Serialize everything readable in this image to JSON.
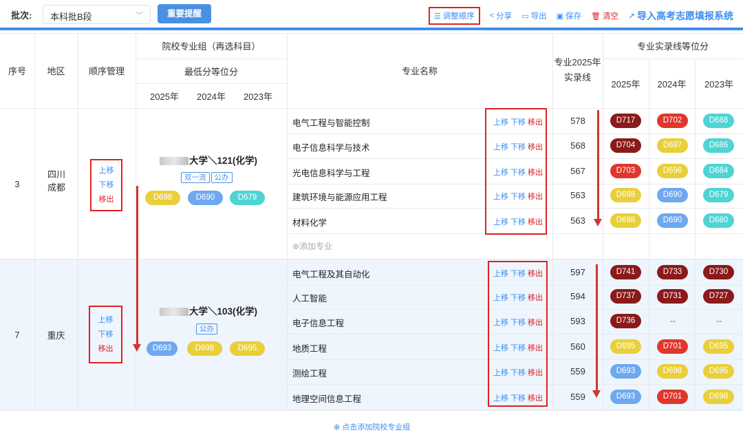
{
  "toolbar": {
    "batch_label": "批次:",
    "batch_value": "本科批B段",
    "remind_btn": "重要提醒",
    "adjust": "调整顺序",
    "share": "分享",
    "export": "导出",
    "save": "保存",
    "clear": "清空",
    "import": "导入高考志愿填报系统"
  },
  "header": {
    "seq": "序号",
    "region": "地区",
    "order_mgmt": "顺序管理",
    "group": "院校专业组（再选科目）",
    "min_rank": "最低分等位分",
    "years": [
      "2025年",
      "2024年",
      "2023年"
    ],
    "major_name": "专业名称",
    "line_2025": "专业2025年实录线",
    "major_rank": "专业实录线等位分"
  },
  "ops": {
    "up": "上移",
    "down": "下移",
    "remove": "移出"
  },
  "add_major": "添加专业",
  "add_group": "点击添加院校专业组",
  "colors": {
    "dark_red": "#8b1a1a",
    "red": "#e0362c",
    "yellow": "#e9cf3a",
    "blue": "#6ea8ee",
    "teal": "#4fd4d4",
    "accent": "#3d8ef0"
  },
  "groups": [
    {
      "seq": "3",
      "region": "四川成都",
      "school": "大学＼121(化学)",
      "tags": [
        "双一流",
        "公办"
      ],
      "ranks": [
        {
          "text": "D698",
          "color": "yellow"
        },
        {
          "text": "D690",
          "color": "blue"
        },
        {
          "text": "D679",
          "color": "teal"
        }
      ],
      "majors": [
        {
          "name": "电气工程与智能控制",
          "score": "578",
          "ranks": [
            {
              "text": "D717",
              "color": "dark_red"
            },
            {
              "text": "D702",
              "color": "red"
            },
            {
              "text": "D688",
              "color": "teal"
            }
          ]
        },
        {
          "name": "电子信息科学与技术",
          "score": "568",
          "ranks": [
            {
              "text": "D704",
              "color": "dark_red"
            },
            {
              "text": "D697",
              "color": "yellow"
            },
            {
              "text": "D686",
              "color": "teal"
            }
          ]
        },
        {
          "name": "光电信息科学与工程",
          "score": "567",
          "ranks": [
            {
              "text": "D703",
              "color": "red"
            },
            {
              "text": "D696",
              "color": "yellow"
            },
            {
              "text": "D684",
              "color": "teal"
            }
          ]
        },
        {
          "name": "建筑环境与能源应用工程",
          "score": "563",
          "ranks": [
            {
              "text": "D698",
              "color": "yellow"
            },
            {
              "text": "D690",
              "color": "blue"
            },
            {
              "text": "D679",
              "color": "teal"
            }
          ]
        },
        {
          "name": "材料化学",
          "score": "563",
          "ranks": [
            {
              "text": "D698",
              "color": "yellow"
            },
            {
              "text": "D690",
              "color": "blue"
            },
            {
              "text": "D680",
              "color": "teal"
            }
          ]
        }
      ]
    },
    {
      "seq": "7",
      "region": "重庆",
      "school": "大学＼103(化学)",
      "tags": [
        "公办"
      ],
      "ranks": [
        {
          "text": "D693",
          "color": "blue"
        },
        {
          "text": "D698",
          "color": "yellow"
        },
        {
          "text": "D695",
          "color": "yellow"
        }
      ],
      "majors": [
        {
          "name": "电气工程及其自动化",
          "score": "597",
          "ranks": [
            {
              "text": "D741",
              "color": "dark_red"
            },
            {
              "text": "D733",
              "color": "dark_red"
            },
            {
              "text": "D730",
              "color": "dark_red"
            }
          ]
        },
        {
          "name": "人工智能",
          "score": "594",
          "ranks": [
            {
              "text": "D737",
              "color": "dark_red"
            },
            {
              "text": "D731",
              "color": "dark_red"
            },
            {
              "text": "D727",
              "color": "dark_red"
            }
          ]
        },
        {
          "name": "电子信息工程",
          "score": "593",
          "ranks": [
            {
              "text": "D736",
              "color": "dark_red"
            },
            {
              "text": "--",
              "color": ""
            },
            {
              "text": "--",
              "color": ""
            }
          ]
        },
        {
          "name": "地质工程",
          "score": "560",
          "ranks": [
            {
              "text": "D695",
              "color": "yellow"
            },
            {
              "text": "D701",
              "color": "red"
            },
            {
              "text": "D695",
              "color": "yellow"
            }
          ]
        },
        {
          "name": "测绘工程",
          "score": "559",
          "ranks": [
            {
              "text": "D693",
              "color": "blue"
            },
            {
              "text": "D698",
              "color": "yellow"
            },
            {
              "text": "D695",
              "color": "yellow"
            }
          ]
        },
        {
          "name": "地理空间信息工程",
          "score": "559",
          "ranks": [
            {
              "text": "D693",
              "color": "blue"
            },
            {
              "text": "D701",
              "color": "red"
            },
            {
              "text": "D698",
              "color": "yellow"
            }
          ]
        }
      ]
    }
  ]
}
